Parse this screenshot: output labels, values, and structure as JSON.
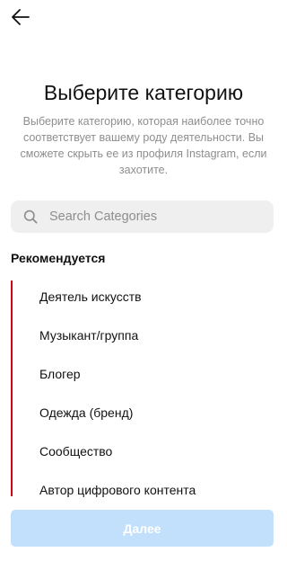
{
  "header": {
    "back_icon": "arrow-left-icon"
  },
  "title": "Выберите категорию",
  "subtitle": "Выберите категорию, которая наиболее точно соответствует вашему роду деятельности. Вы сможете скрыть ее из профиля Instagram, если захотите.",
  "search": {
    "icon": "search-icon",
    "placeholder": "Search Categories",
    "value": ""
  },
  "section_label": "Рекомендуется",
  "categories": [
    {
      "label": "Деятель искусств"
    },
    {
      "label": "Музыкант/группа"
    },
    {
      "label": "Блогер"
    },
    {
      "label": "Одежда (бренд)"
    },
    {
      "label": "Сообщество"
    },
    {
      "label": "Автор цифрового контента"
    }
  ],
  "next_button": {
    "label": "Далее",
    "enabled": false
  },
  "colors": {
    "accent_disabled": "#c2e0fc",
    "highlight_bar": "#d0021b",
    "secondary_text": "#8e8e8e",
    "search_background": "#efefef"
  }
}
